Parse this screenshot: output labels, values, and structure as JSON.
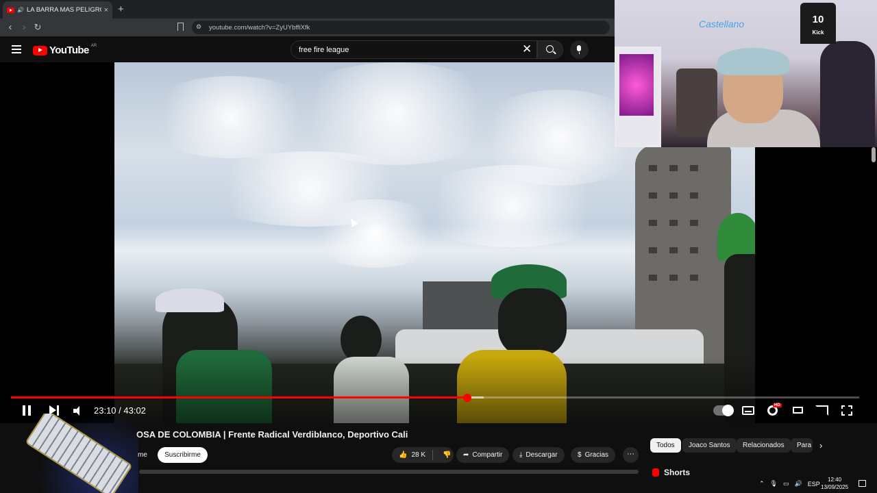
{
  "browser": {
    "tab_title": "LA BARRA MAS PELIGROSA D",
    "tab_close": "×",
    "new_tab": "+",
    "url": "youtube.com/watch?v=ZyUYbffiXfk"
  },
  "youtube": {
    "logo": "YouTube",
    "country_code": "AR",
    "search_value": "free fire league"
  },
  "player": {
    "current_time": "23:10",
    "duration": "43:02",
    "time_display": "23:10 / 43:02",
    "progress_fraction": 0.5383,
    "buffer_fraction": 0.557,
    "hd_badge": "HD"
  },
  "video": {
    "title_visible": "OSA DE COLOMBIA | Frente Radical Verdiblanco, Deportivo Cali",
    "channel_partial": "me",
    "subscribe_label": "Suscribirme",
    "likes": "28 K",
    "share_label": "Compartir",
    "download_label": "Descargar",
    "thanks_label": "Gracias",
    "more_label": "···"
  },
  "chips": [
    "Todos",
    "Joaco Santos",
    "Relacionados",
    "Para"
  ],
  "sidebar": {
    "shorts_label": "Shorts"
  },
  "webcam": {
    "poster_text": "Castellano",
    "jersey_number": "10",
    "jersey_name": "Kick"
  },
  "taskbar": {
    "language": "ESP",
    "time": "12:40",
    "date": "13/09/2025"
  },
  "colors": {
    "accent": "#ff0000",
    "background": "#0f0f0f",
    "chip_bg": "#272727"
  }
}
